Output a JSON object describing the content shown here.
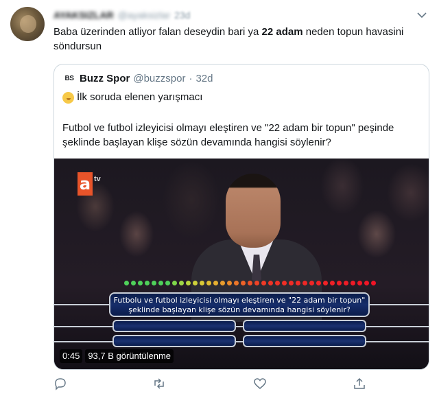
{
  "tweet": {
    "author_name": "AYAKSIZLAR",
    "author_handle": "@ayaksizlar",
    "time": "23d",
    "text_prefix": "Baba üzerinden atliyor falan deseydin  bari ya ",
    "text_bold": "22 adam",
    "text_suffix": " neden topun havasini söndursun"
  },
  "quote": {
    "logo": "BS",
    "name": "Buzz Spor",
    "handle": "@buzzspor",
    "separator": "·",
    "time": "32d",
    "line1_icon": "yawning-face-emoji",
    "line1": "İlk soruda elenen yarışmacı",
    "body": "Futbol ve futbol izleyicisi olmayı eleştiren ve \"22 adam bir topun\" peşinde şeklinde başlayan klişe sözün devamında hangisi söylenir?"
  },
  "video": {
    "channel_logo": "a",
    "channel_logo_suffix": "tv",
    "question_line1": "Futbolu ve futbol izleyicisi olmayı eleştiren ve \"22 adam bir topun\"",
    "question_line2": "şeklinde başlayan klişe sözün devamında hangisi söylenir?",
    "duration": "0:45",
    "views": "93,7 B görüntülenme"
  },
  "actions": [
    {
      "name": "reply-icon"
    },
    {
      "name": "retweet-icon"
    },
    {
      "name": "like-icon"
    },
    {
      "name": "share-icon"
    }
  ],
  "colors": {
    "accent": "#1da1f2",
    "muted": "#8899a6",
    "border": "#ccd6dd",
    "logo_orange": "#e8542a",
    "panel_navy": "#0b1d4c"
  }
}
